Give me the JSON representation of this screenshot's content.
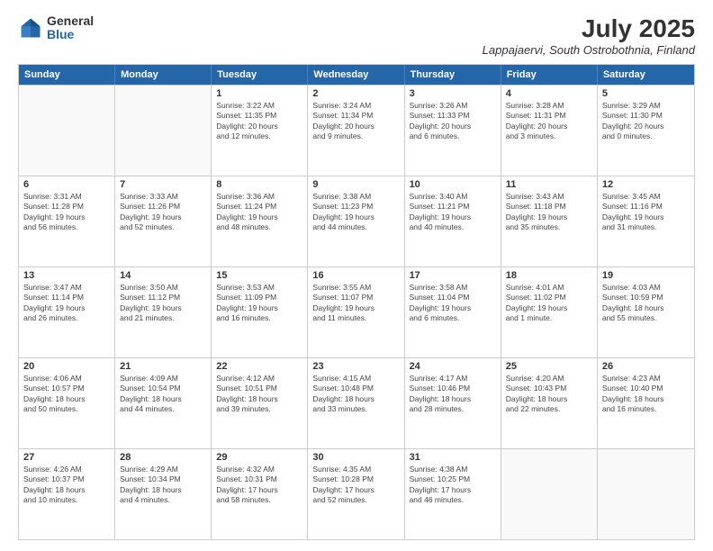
{
  "header": {
    "logo_general": "General",
    "logo_blue": "Blue",
    "title": "July 2025",
    "location": "Lappajaervi, South Ostrobothnia, Finland"
  },
  "days_of_week": [
    "Sunday",
    "Monday",
    "Tuesday",
    "Wednesday",
    "Thursday",
    "Friday",
    "Saturday"
  ],
  "weeks": [
    [
      {
        "day": "",
        "text": ""
      },
      {
        "day": "",
        "text": ""
      },
      {
        "day": "1",
        "text": "Sunrise: 3:22 AM\nSunset: 11:35 PM\nDaylight: 20 hours\nand 12 minutes."
      },
      {
        "day": "2",
        "text": "Sunrise: 3:24 AM\nSunset: 11:34 PM\nDaylight: 20 hours\nand 9 minutes."
      },
      {
        "day": "3",
        "text": "Sunrise: 3:26 AM\nSunset: 11:33 PM\nDaylight: 20 hours\nand 6 minutes."
      },
      {
        "day": "4",
        "text": "Sunrise: 3:28 AM\nSunset: 11:31 PM\nDaylight: 20 hours\nand 3 minutes."
      },
      {
        "day": "5",
        "text": "Sunrise: 3:29 AM\nSunset: 11:30 PM\nDaylight: 20 hours\nand 0 minutes."
      }
    ],
    [
      {
        "day": "6",
        "text": "Sunrise: 3:31 AM\nSunset: 11:28 PM\nDaylight: 19 hours\nand 56 minutes."
      },
      {
        "day": "7",
        "text": "Sunrise: 3:33 AM\nSunset: 11:26 PM\nDaylight: 19 hours\nand 52 minutes."
      },
      {
        "day": "8",
        "text": "Sunrise: 3:36 AM\nSunset: 11:24 PM\nDaylight: 19 hours\nand 48 minutes."
      },
      {
        "day": "9",
        "text": "Sunrise: 3:38 AM\nSunset: 11:23 PM\nDaylight: 19 hours\nand 44 minutes."
      },
      {
        "day": "10",
        "text": "Sunrise: 3:40 AM\nSunset: 11:21 PM\nDaylight: 19 hours\nand 40 minutes."
      },
      {
        "day": "11",
        "text": "Sunrise: 3:43 AM\nSunset: 11:18 PM\nDaylight: 19 hours\nand 35 minutes."
      },
      {
        "day": "12",
        "text": "Sunrise: 3:45 AM\nSunset: 11:16 PM\nDaylight: 19 hours\nand 31 minutes."
      }
    ],
    [
      {
        "day": "13",
        "text": "Sunrise: 3:47 AM\nSunset: 11:14 PM\nDaylight: 19 hours\nand 26 minutes."
      },
      {
        "day": "14",
        "text": "Sunrise: 3:50 AM\nSunset: 11:12 PM\nDaylight: 19 hours\nand 21 minutes."
      },
      {
        "day": "15",
        "text": "Sunrise: 3:53 AM\nSunset: 11:09 PM\nDaylight: 19 hours\nand 16 minutes."
      },
      {
        "day": "16",
        "text": "Sunrise: 3:55 AM\nSunset: 11:07 PM\nDaylight: 19 hours\nand 11 minutes."
      },
      {
        "day": "17",
        "text": "Sunrise: 3:58 AM\nSunset: 11:04 PM\nDaylight: 19 hours\nand 6 minutes."
      },
      {
        "day": "18",
        "text": "Sunrise: 4:01 AM\nSunset: 11:02 PM\nDaylight: 19 hours\nand 1 minute."
      },
      {
        "day": "19",
        "text": "Sunrise: 4:03 AM\nSunset: 10:59 PM\nDaylight: 18 hours\nand 55 minutes."
      }
    ],
    [
      {
        "day": "20",
        "text": "Sunrise: 4:06 AM\nSunset: 10:57 PM\nDaylight: 18 hours\nand 50 minutes."
      },
      {
        "day": "21",
        "text": "Sunrise: 4:09 AM\nSunset: 10:54 PM\nDaylight: 18 hours\nand 44 minutes."
      },
      {
        "day": "22",
        "text": "Sunrise: 4:12 AM\nSunset: 10:51 PM\nDaylight: 18 hours\nand 39 minutes."
      },
      {
        "day": "23",
        "text": "Sunrise: 4:15 AM\nSunset: 10:48 PM\nDaylight: 18 hours\nand 33 minutes."
      },
      {
        "day": "24",
        "text": "Sunrise: 4:17 AM\nSunset: 10:46 PM\nDaylight: 18 hours\nand 28 minutes."
      },
      {
        "day": "25",
        "text": "Sunrise: 4:20 AM\nSunset: 10:43 PM\nDaylight: 18 hours\nand 22 minutes."
      },
      {
        "day": "26",
        "text": "Sunrise: 4:23 AM\nSunset: 10:40 PM\nDaylight: 18 hours\nand 16 minutes."
      }
    ],
    [
      {
        "day": "27",
        "text": "Sunrise: 4:26 AM\nSunset: 10:37 PM\nDaylight: 18 hours\nand 10 minutes."
      },
      {
        "day": "28",
        "text": "Sunrise: 4:29 AM\nSunset: 10:34 PM\nDaylight: 18 hours\nand 4 minutes."
      },
      {
        "day": "29",
        "text": "Sunrise: 4:32 AM\nSunset: 10:31 PM\nDaylight: 17 hours\nand 58 minutes."
      },
      {
        "day": "30",
        "text": "Sunrise: 4:35 AM\nSunset: 10:28 PM\nDaylight: 17 hours\nand 52 minutes."
      },
      {
        "day": "31",
        "text": "Sunrise: 4:38 AM\nSunset: 10:25 PM\nDaylight: 17 hours\nand 46 minutes."
      },
      {
        "day": "",
        "text": ""
      },
      {
        "day": "",
        "text": ""
      }
    ]
  ]
}
